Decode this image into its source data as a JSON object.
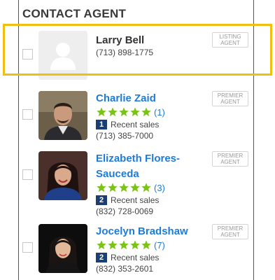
{
  "header": {
    "title": "CONTACT AGENT"
  },
  "agents": [
    {
      "name": "Larry Bell",
      "phone": "(713) 898-1775",
      "badge_line1": "LISTING",
      "badge_line2": "AGENT"
    },
    {
      "name": "Charlie Zaid",
      "rating": "(1)",
      "sales_count": "1",
      "sales_label": "Recent sales",
      "phone": "(713) 385-7000",
      "badge_line1": "PREMIER",
      "badge_line2": "AGENT"
    },
    {
      "name_line1": "Elizabeth Flores-",
      "name_line2": "Sauceda",
      "rating": "(3)",
      "sales_count": "2",
      "sales_label": "Recent sales",
      "phone": "(832) 728-0069",
      "badge_line1": "PREMIER",
      "badge_line2": "AGENT"
    },
    {
      "name": "Jocelyn Bradshaw",
      "rating": "(7)",
      "sales_count": "2",
      "sales_label": "Recent sales",
      "phone": "(832) 353-2601",
      "badge_line1": "PREMIER",
      "badge_line2": "AGENT"
    }
  ],
  "colors": {
    "accent": "#1f7bd8",
    "star": "#7bc417",
    "highlight": "#f0c010",
    "sales_badge": "#1b3f73"
  }
}
